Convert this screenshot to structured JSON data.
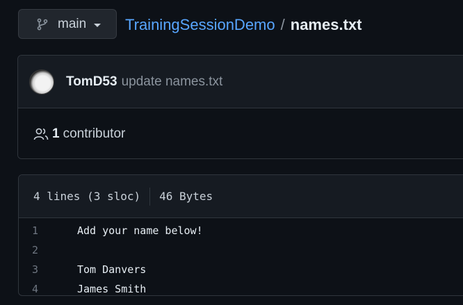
{
  "branch": {
    "label": "main",
    "icon": "git-branch-icon"
  },
  "breadcrumb": {
    "repo": "TrainingSessionDemo",
    "separator": "/",
    "file": "names.txt"
  },
  "commit": {
    "author": "TomD53",
    "message": "update names.txt"
  },
  "contributors": {
    "icon": "people-icon",
    "count": "1",
    "label": "contributor"
  },
  "file_info": {
    "lines": "4 lines (3 sloc)",
    "size": "46 Bytes"
  },
  "code_lines": [
    {
      "number": "1",
      "text": "Add your name below!"
    },
    {
      "number": "2",
      "text": ""
    },
    {
      "number": "3",
      "text": "Tom Danvers"
    },
    {
      "number": "4",
      "text": "James Smith"
    }
  ],
  "colors": {
    "background": "#0d1117",
    "panel": "#161b22",
    "border": "#30363d",
    "link": "#58a6ff",
    "muted": "#8b949e"
  }
}
